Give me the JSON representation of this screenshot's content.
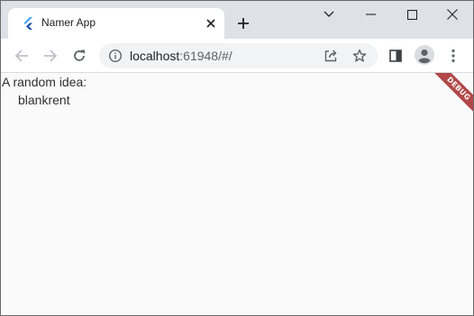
{
  "browser": {
    "tab": {
      "title": "Namer App",
      "favicon": "flutter-logo-icon",
      "close_icon": "close-icon"
    },
    "new_tab_icon": "plus-icon",
    "window_controls": [
      "chevron-down-icon",
      "minimize-icon",
      "maximize-icon",
      "close-icon"
    ],
    "toolbar": {
      "back_icon": "arrow-left-icon",
      "forward_icon": "arrow-right-icon",
      "reload_icon": "reload-icon",
      "url_host": "localhost",
      "url_rest": ":61948/#/",
      "site_info_icon": "info-icon",
      "share_icon": "share-icon",
      "bookmark_icon": "star-icon",
      "side_panel_icon": "side-panel-icon",
      "profile_icon": "avatar-icon",
      "menu_icon": "kebab-menu-icon"
    }
  },
  "page": {
    "caption": "A random idea:",
    "idea": "blankrent",
    "debug_banner": "DEBUG",
    "debug_color": "#a52a2a",
    "background": "#fafafa"
  }
}
